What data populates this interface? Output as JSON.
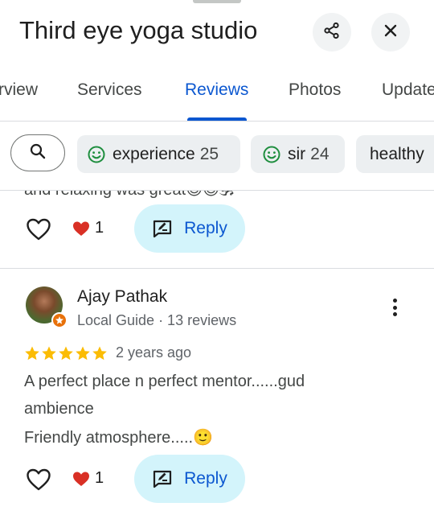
{
  "header": {
    "title": "Third eye yoga studio",
    "share_icon": "share-icon",
    "close_icon": "close-icon"
  },
  "tabs": [
    {
      "label": "Overview",
      "visible_label": "rview"
    },
    {
      "label": "Services"
    },
    {
      "label": "Reviews",
      "active": true
    },
    {
      "label": "Photos"
    },
    {
      "label": "Updates",
      "visible_label": "Update"
    }
  ],
  "filter_chips": {
    "search_icon": "search-icon",
    "items": [
      {
        "label": "experience",
        "count": "25",
        "icon": "smile-icon"
      },
      {
        "label": "sir",
        "count": "24",
        "icon": "smile-icon"
      },
      {
        "label": "healthy",
        "count": ""
      }
    ]
  },
  "previous_review": {
    "partial_text": "and relaxing was great😊😊🕉",
    "likes": "1",
    "reply_label": "Reply"
  },
  "review": {
    "author": "Ajay Pathak",
    "meta": "Local Guide · 13 reviews",
    "rating": 5,
    "date": "2 years ago",
    "lines": [
      "A perfect place n perfect mentor......gud",
      "ambience",
      "Friendly atmosphere.....🙂"
    ],
    "likes": "1",
    "reply_label": "Reply"
  },
  "colors": {
    "accent": "#0b57d0",
    "reply_bg": "#d3f4fb",
    "chip_bg": "#eceff1",
    "star": "#fbbc04",
    "smile": "#1e8e3e",
    "like_heart": "#d93025",
    "guide_badge": "#e8710a"
  }
}
